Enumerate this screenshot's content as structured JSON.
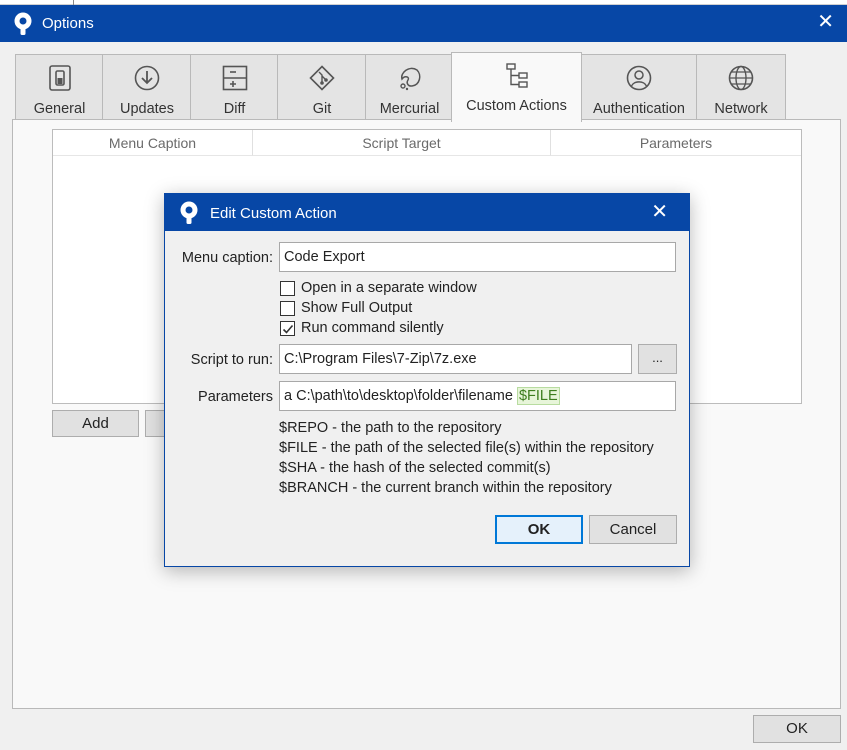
{
  "window": {
    "title": "Options"
  },
  "tabs": [
    {
      "label": "General",
      "icon": "toggle-switch-icon"
    },
    {
      "label": "Updates",
      "icon": "download-circle-icon"
    },
    {
      "label": "Diff",
      "icon": "diff-plus-minus-icon"
    },
    {
      "label": "Git",
      "icon": "git-diamond-icon"
    },
    {
      "label": "Mercurial",
      "icon": "mercurial-drop-icon"
    },
    {
      "label": "Custom Actions",
      "icon": "hierarchy-tree-icon",
      "active": true
    },
    {
      "label": "Authentication",
      "icon": "user-circle-icon"
    },
    {
      "label": "Network",
      "icon": "globe-icon"
    }
  ],
  "grid": {
    "columns": [
      "Menu Caption",
      "Script Target",
      "Parameters"
    ],
    "rows": []
  },
  "panel": {
    "add_label": "Add",
    "ok_label": "OK"
  },
  "dialog": {
    "title": "Edit Custom Action",
    "menu_caption_label": "Menu caption:",
    "menu_caption_value": "Code Export",
    "checkboxes": [
      {
        "label": "Open in a separate window",
        "checked": false
      },
      {
        "label": "Show Full Output",
        "checked": false
      },
      {
        "label": "Run command silently",
        "checked": true
      }
    ],
    "script_label": "Script to run:",
    "script_value": "C:\\Program Files\\7-Zip\\7z.exe",
    "browse_label": "...",
    "params_label": "Parameters",
    "params_value_text": "a C:\\path\\to\\desktop\\folder\\filename ",
    "params_value_var": "$FILE",
    "help_lines": [
      "$REPO - the path to the repository",
      "$FILE - the path of the selected file(s) within the repository",
      "$SHA - the hash of the selected commit(s)",
      "$BRANCH - the current branch within the repository"
    ],
    "ok_label": "OK",
    "cancel_label": "Cancel"
  },
  "colors": {
    "accent": "#0747a6",
    "window_bg": "#f0f0f0",
    "panel_bg": "#f9f9f9",
    "highlight": "#e7f5d9"
  }
}
